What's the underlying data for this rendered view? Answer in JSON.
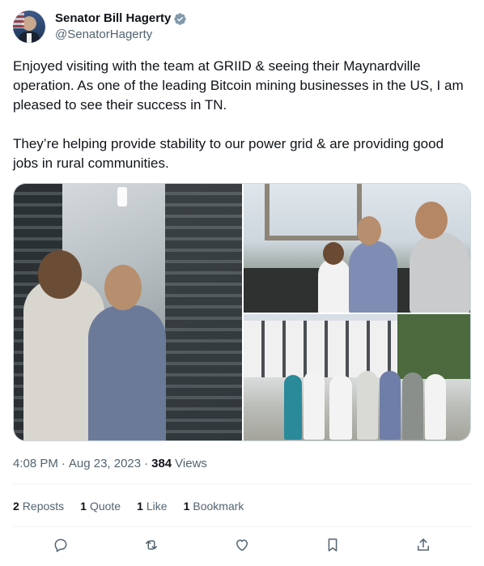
{
  "author": {
    "display_name": "Senator Bill Hagerty",
    "handle": "@SenatorHagerty",
    "verified_badge": "verified-gray-icon",
    "badge_color": "#829aab"
  },
  "tweet": {
    "text": "Enjoyed visiting with the team at GRIID & seeing their Maynardville operation. As one of the leading Bitcoin mining businesses in the US, I am pleased to see their success in TN.\n\nThey’re helping provide stability to our power grid & are providing good jobs in rural communities."
  },
  "meta": {
    "time": "4:08 PM",
    "date": "Aug 23, 2023",
    "views_count": "384",
    "views_label": "Views"
  },
  "stats": {
    "reposts_count": "2",
    "reposts_label": "Reposts",
    "quotes_count": "1",
    "quotes_label": "Quote",
    "likes_count": "1",
    "likes_label": "Like",
    "bookmarks_count": "1",
    "bookmarks_label": "Bookmark"
  },
  "actions": [
    "reply-icon",
    "repost-icon",
    "like-icon",
    "bookmark-icon",
    "share-icon"
  ],
  "colors": {
    "text_primary": "#0f1419",
    "text_secondary": "#536471",
    "divider": "#eff3f4"
  }
}
